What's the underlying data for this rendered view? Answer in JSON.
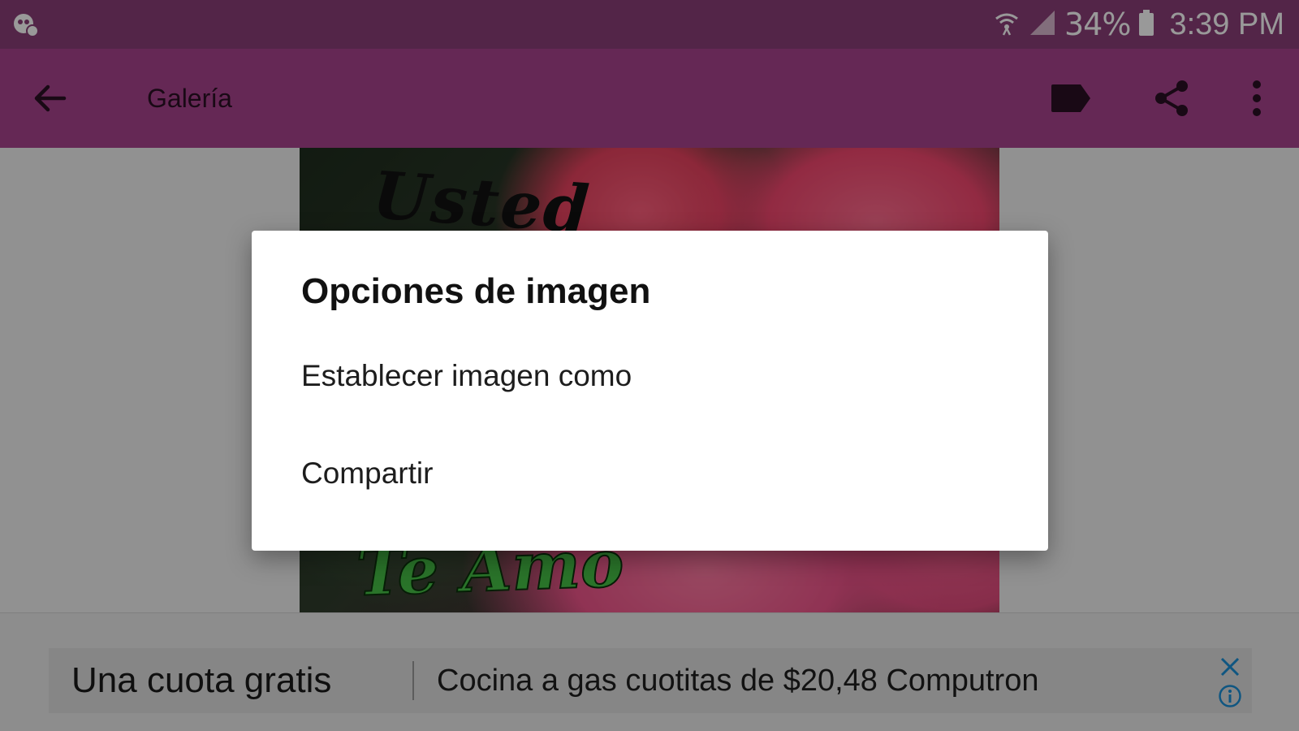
{
  "status_bar": {
    "battery_percent": "34%",
    "time": "3:39 PM",
    "left_icon": "app-notification-icon",
    "icons": [
      "wifi-icon",
      "signal-icon",
      "battery-icon"
    ]
  },
  "app_bar": {
    "title": "Galería",
    "back_icon": "arrow-back-icon",
    "action_icons": [
      "label-icon",
      "share-icon",
      "more-vert-icon"
    ],
    "color": "#a8438e"
  },
  "image": {
    "top_text": "Usted",
    "bottom_text": "Te Amo"
  },
  "dialog": {
    "title": "Opciones de imagen",
    "items": [
      {
        "label": "Establecer imagen como"
      },
      {
        "label": "Compartir"
      }
    ]
  },
  "ad": {
    "headline": "Una cuota gratis",
    "body": "Cocina a gas cuotitas de $20,48 Computron",
    "close_icon": "close-icon",
    "info_icon": "info-icon",
    "accent": "#1a8fd8"
  }
}
